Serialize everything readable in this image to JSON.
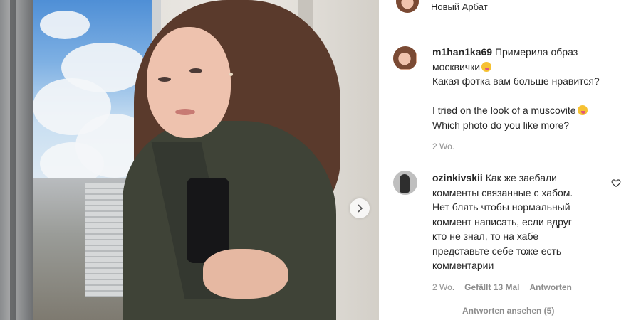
{
  "post": {
    "location": "Новый Арбат"
  },
  "caption": {
    "username": "m1han1ka69",
    "line1": "Примерила образ",
    "line2": "москвички",
    "line3": "Какая фотка вам больше нравится?",
    "line4": "I tried on the look of a muscovite",
    "line5": "Which photo do you like more?",
    "time": "2 Wo."
  },
  "comment": {
    "username": "ozinkivskii",
    "line1": "Как же заебали",
    "line2": "комменты связанные с хабом.",
    "line3": "Нет блять чтобы нормальный",
    "line4": "коммент написать, если вдруг",
    "line5": "кто не знал, то на хабе",
    "line6": "представьте себе тоже есть",
    "line7": "комментарии",
    "time": "2 Wo.",
    "likes": "Gefällt 13 Mal",
    "reply": "Antworten",
    "view_replies": "Antworten ansehen (5)"
  },
  "icons": {
    "next": "chevron-right-icon",
    "like": "heart-icon",
    "emoji": "smiling-face-with-tongue-emoji"
  }
}
